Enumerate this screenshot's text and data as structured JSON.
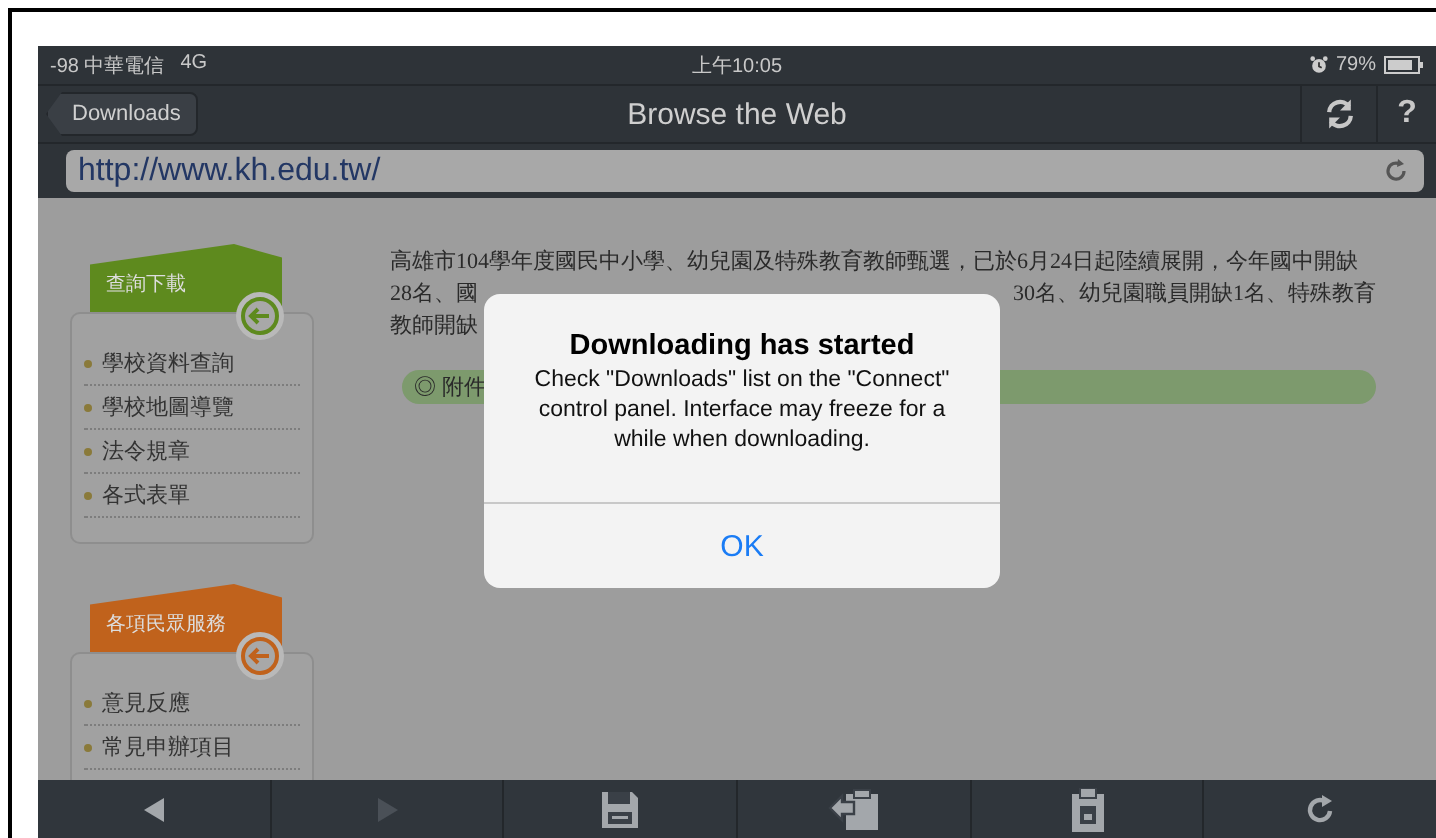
{
  "status_bar": {
    "carrier": "-98 中華電信",
    "network": "4G",
    "time": "上午10:05",
    "battery": "79%"
  },
  "nav_bar": {
    "back_button": "Downloads",
    "title": "Browse the Web",
    "help_button": "?"
  },
  "address_bar": {
    "value": "http://www.kh.edu.tw/"
  },
  "sidebar": {
    "sections": [
      {
        "title": "查詢下載",
        "color": "#5e8a1e",
        "items": [
          "學校資料查詢",
          "學校地圖導覽",
          "法令規章",
          "各式表單"
        ]
      },
      {
        "title": "各項民眾服務",
        "color": "#c0621c",
        "items": [
          "意見反應",
          "常見申辦項目"
        ]
      }
    ]
  },
  "article": {
    "lines": [
      {
        "segments": [
          "高雄市104學年度國民中小學、幼兒園及特殊教育教師甄選，已於6月24日起陸續展開，今年國中開缺"
        ]
      },
      {
        "segments": [
          "28名、國",
          "30名、幼兒園職員開缺1名、特殊教育"
        ]
      },
      {
        "segments": [
          "教師開缺"
        ]
      }
    ],
    "attachment": "◎ 附件"
  },
  "dialog": {
    "title": "Downloading has started",
    "message": "Check \"Downloads\" list on the \"Connect\" control panel. Interface may freeze for a while when downloading.",
    "button": "OK"
  },
  "toolbar": {
    "buttons": [
      {
        "kind": "back",
        "disabled": false
      },
      {
        "kind": "forward",
        "disabled": true
      },
      {
        "kind": "save",
        "disabled": false
      },
      {
        "kind": "share",
        "disabled": false
      },
      {
        "kind": "clipboard",
        "disabled": false
      },
      {
        "kind": "refresh",
        "disabled": false
      }
    ]
  }
}
